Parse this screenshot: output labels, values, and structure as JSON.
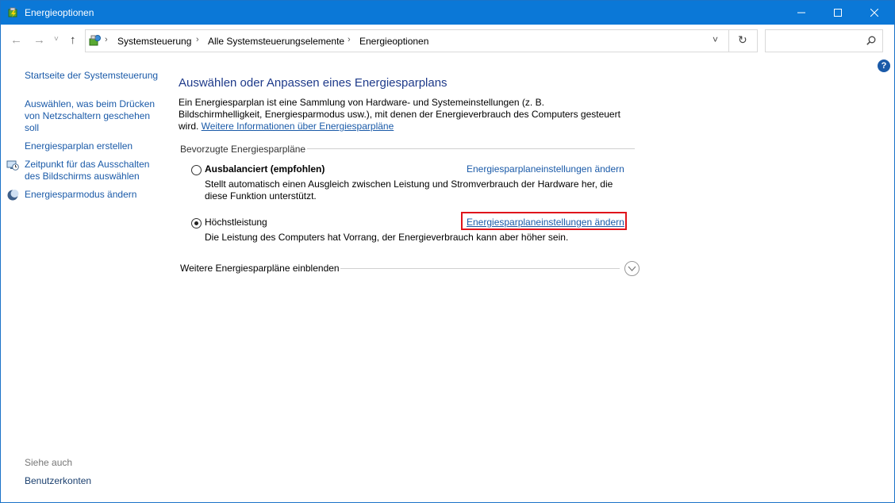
{
  "window": {
    "title": "Energieoptionen",
    "controls": {
      "minimize": "—",
      "maximize": "☐",
      "close": "✕"
    }
  },
  "nav": {
    "back": "←",
    "forward": "→",
    "history": "˅",
    "up": "↑",
    "breadcrumb": [
      "Systemsteuerung",
      "Alle Systemsteuerungselemente",
      "Energieoptionen"
    ],
    "dropdown": "˅",
    "refresh": "↻",
    "search_placeholder": "",
    "search_icon": "⚲"
  },
  "sidebar": {
    "items": [
      {
        "label": "Startseite der Systemsteuerung",
        "icon": ""
      },
      {
        "label": "Auswählen, was beim Drücken von Netzschaltern geschehen soll",
        "icon": ""
      },
      {
        "label": "Energiesparplan erstellen",
        "icon": ""
      },
      {
        "label": "Zeitpunkt für das Ausschalten des Bildschirms auswählen",
        "icon": "monitor-clock-icon"
      },
      {
        "label": "Energiesparmodus ändern",
        "icon": "moon-icon"
      }
    ],
    "see_also": "Siehe auch",
    "see_also_items": [
      "Benutzerkonten"
    ]
  },
  "main": {
    "title": "Auswählen oder Anpassen eines Energiesparplans",
    "intro_text": "Ein Energiesparplan ist eine Sammlung von Hardware- und Systemeinstellungen (z. B. Bildschirmhelligkeit, Energiesparmodus usw.), mit denen der Energieverbrauch des Computers gesteuert wird. ",
    "intro_link": "Weitere Informationen über Energiesparpläne",
    "group_label": "Bevorzugte Energiesparpläne",
    "plans": [
      {
        "name": "Ausbalanciert (empfohlen)",
        "selected": false,
        "bold": true,
        "description": "Stellt automatisch einen Ausgleich zwischen Leistung und Stromverbrauch der Hardware her, die diese Funktion unterstützt.",
        "link": "Energiesparplaneinstellungen ändern"
      },
      {
        "name": "Höchstleistung",
        "selected": true,
        "bold": false,
        "description": "Die Leistung des Computers hat Vorrang, der Energieverbrauch kann aber höher sein.",
        "link": "Energiesparplaneinstellungen ändern"
      }
    ],
    "more_plans_label": "Weitere Energiesparpläne einblenden",
    "help": "?"
  },
  "colors": {
    "titlebar": "#0b78d7",
    "link": "#1a5aa8",
    "title": "#1e3a8a",
    "highlight": "#e0141b"
  }
}
